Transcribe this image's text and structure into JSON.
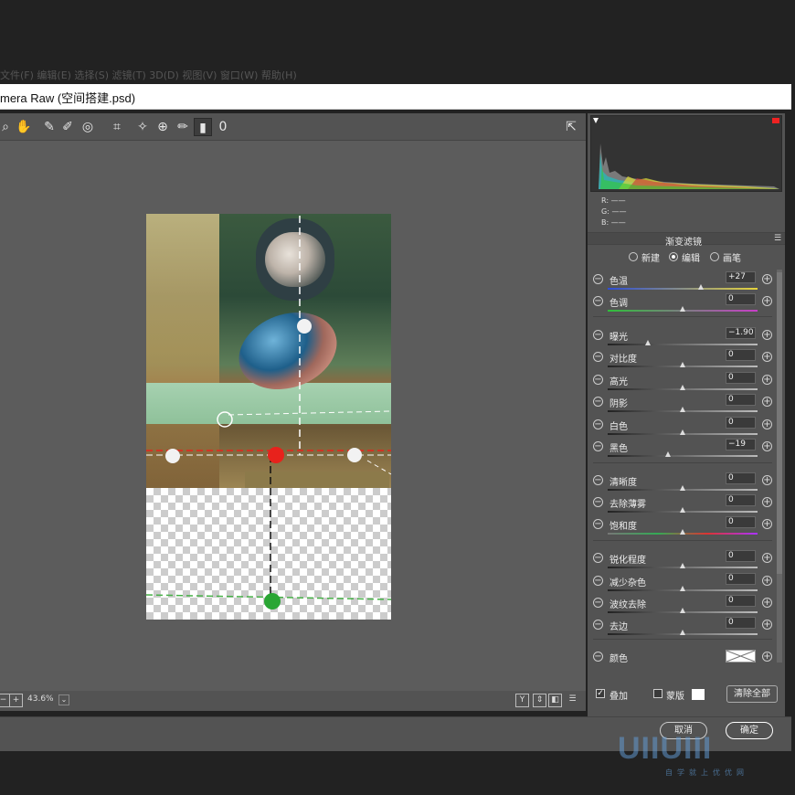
{
  "window": {
    "title": "mera Raw (空间搭建.psd)",
    "menu": "文件(F) 编辑(E) 选择(S) 滤镜(T) 3D(D) 视图(V) 窗口(W) 帮助(H)"
  },
  "toolbar": {
    "tools": [
      {
        "name": "zoom-tool-icon",
        "glyph": "⌕"
      },
      {
        "name": "hand-tool-icon",
        "glyph": "✋"
      },
      {
        "name": "white-balance-tool-icon",
        "glyph": "✎"
      },
      {
        "name": "color-sampler-tool-icon",
        "glyph": "✐"
      },
      {
        "name": "targeted-adjustment-tool-icon",
        "glyph": "◎"
      },
      {
        "name": "crop-tool-icon",
        "glyph": "⌗"
      },
      {
        "name": "spot-removal-tool-icon",
        "glyph": "✧"
      },
      {
        "name": "red-eye-tool-icon",
        "glyph": "⊕"
      },
      {
        "name": "adjustment-brush-icon",
        "glyph": "✏"
      },
      {
        "name": "graduated-filter-icon",
        "glyph": "▮"
      },
      {
        "name": "radial-filter-icon",
        "glyph": "0"
      }
    ],
    "fullscreen_icon": "⇱"
  },
  "bottom": {
    "zoom": "43.6%",
    "zoom_minus": "−",
    "zoom_plus": "+",
    "view_buttons": [
      "Y",
      "⇕",
      "◧",
      "☰"
    ]
  },
  "histogram": {
    "r_label": "R:",
    "g_label": "G:",
    "b_label": "B:",
    "r_value": "——",
    "g_value": "——",
    "b_value": "——"
  },
  "panel": {
    "title": "渐变滤镜",
    "modes": [
      {
        "label": "新建",
        "selected": false
      },
      {
        "label": "编辑",
        "selected": true
      },
      {
        "label": "画笔",
        "selected": false
      }
    ],
    "sliders": [
      {
        "label": "色温",
        "value": "+27",
        "fraction": 0.62,
        "track": "temp"
      },
      {
        "label": "色调",
        "value": "0",
        "fraction": 0.5,
        "track": "tint"
      },
      {
        "label": "曝光",
        "value": "−1.90",
        "fraction": 0.27,
        "track": "gray"
      },
      {
        "label": "对比度",
        "value": "0",
        "fraction": 0.5,
        "track": "gray"
      },
      {
        "label": "高光",
        "value": "0",
        "fraction": 0.5,
        "track": "gray"
      },
      {
        "label": "阴影",
        "value": "0",
        "fraction": 0.5,
        "track": "gray"
      },
      {
        "label": "白色",
        "value": "0",
        "fraction": 0.5,
        "track": "gray"
      },
      {
        "label": "黑色",
        "value": "−19",
        "fraction": 0.4,
        "track": "gray"
      },
      {
        "label": "清晰度",
        "value": "0",
        "fraction": 0.5,
        "track": "gray"
      },
      {
        "label": "去除薄雾",
        "value": "0",
        "fraction": 0.5,
        "track": "gray"
      },
      {
        "label": "饱和度",
        "value": "0",
        "fraction": 0.5,
        "track": "sat"
      },
      {
        "label": "锐化程度",
        "value": "0",
        "fraction": 0.5,
        "track": "gray"
      },
      {
        "label": "减少杂色",
        "value": "0",
        "fraction": 0.5,
        "track": "gray"
      },
      {
        "label": "波纹去除",
        "value": "0",
        "fraction": 0.5,
        "track": "gray"
      },
      {
        "label": "去边",
        "value": "0",
        "fraction": 0.5,
        "track": "gray"
      }
    ],
    "color_label": "颜色",
    "minus_glyph": "−",
    "plus_glyph": "+"
  },
  "overlay": {
    "show_overlay_label": "叠加",
    "show_overlay_checked": true,
    "mask_label": "蒙版",
    "mask_checked": false,
    "clear_all_label": "清除全部",
    "check_glyph": "✓"
  },
  "footer": {
    "cancel_label": "取消",
    "ok_label": "确定"
  },
  "watermark": {
    "text": "UIIUIII",
    "subtitle": "自学就上优优网"
  },
  "colors": {
    "pin_red": "#e8221c",
    "pin_green": "#2aa634",
    "pin_white": "#f2f2f2",
    "guide_red": "#d43b2a",
    "guide_green": "#46b046"
  }
}
